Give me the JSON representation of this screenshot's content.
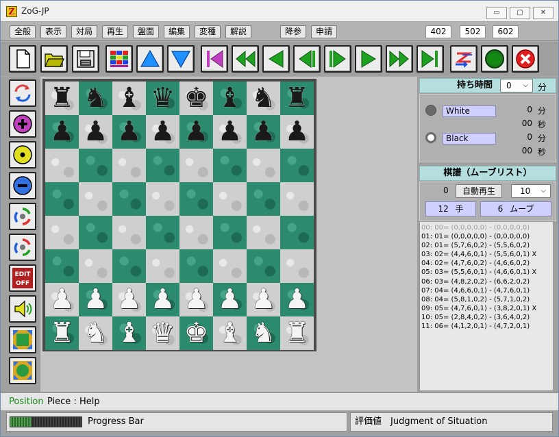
{
  "window": {
    "title": "ZoG-JP",
    "app_icon_letter": "Z",
    "minimize_glyph": "▭",
    "maximize_glyph": "▢",
    "close_glyph": "✕"
  },
  "menu": {
    "items": [
      "全般",
      "表示",
      "対局",
      "再生",
      "盤面",
      "編集",
      "変種",
      "解説"
    ],
    "right_items": [
      "降参",
      "申請"
    ],
    "numbers": [
      "402",
      "502",
      "602"
    ]
  },
  "toolbar": {
    "icons": [
      "new-file-icon",
      "open-folder-icon",
      "save-disk-icon",
      "board-grid-icon",
      "triangle-up-icon",
      "triangle-down-icon",
      "go-first-icon",
      "fast-back-icon",
      "step-back-icon",
      "back-pause-icon",
      "play-pause-icon",
      "step-forward-icon",
      "fast-forward-icon",
      "go-last-icon",
      "zog-swap-icon",
      "green-circle-icon",
      "red-x-icon"
    ]
  },
  "leftbar": {
    "icons": [
      "rotate-board-icon",
      "plus-icon",
      "dot-icon",
      "minus-icon",
      "cycle-icon",
      "cycle-alt-icon",
      "edit-off-icon",
      "speaker-icon",
      "expand-icon",
      "fit-icon"
    ],
    "edit_off_text_1": "EDIT",
    "edit_off_text_2": "OFF"
  },
  "board": {
    "rows": [
      [
        "r",
        "n",
        "b",
        "q",
        "k",
        "b",
        "n",
        "r"
      ],
      [
        "p",
        "p",
        "p",
        "p",
        "p",
        "p",
        "p",
        "p"
      ],
      [
        "",
        "",
        "",
        "",
        "",
        "",
        "",
        ""
      ],
      [
        "",
        "",
        "",
        "",
        "",
        "",
        "",
        ""
      ],
      [
        "",
        "",
        "",
        "",
        "",
        "",
        "",
        ""
      ],
      [
        "",
        "",
        "",
        "",
        "",
        "",
        "",
        ""
      ],
      [
        "P",
        "P",
        "P",
        "P",
        "P",
        "P",
        "P",
        "P"
      ],
      [
        "R",
        "N",
        "B",
        "Q",
        "K",
        "B",
        "N",
        "R"
      ]
    ],
    "glyphs": {
      "r": "♜",
      "n": "♞",
      "b": "♝",
      "q": "♛",
      "k": "♚",
      "p": "♟",
      "R": "♜",
      "N": "♞",
      "B": "♝",
      "Q": "♛",
      "K": "♚",
      "P": "♟"
    }
  },
  "time_panel": {
    "title": "持ち時間",
    "minutes_value": "0",
    "minutes_unit": "分",
    "players": [
      {
        "name": "White",
        "minutes": "0",
        "seconds": "00",
        "min_unit": "分",
        "sec_unit": "秒",
        "active": true
      },
      {
        "name": "Black",
        "minutes": "0",
        "seconds": "00",
        "min_unit": "分",
        "sec_unit": "秒",
        "active": false
      }
    ]
  },
  "moves_panel": {
    "title": "棋譜（ムーブリスト）",
    "position_index": "0",
    "autoplay_label": "自動再生",
    "speed_value": "10",
    "hands_count": "12",
    "hands_unit": "手",
    "moves_count": "6",
    "moves_unit": "ムーブ",
    "list": [
      "00: 00= (0,0,0,0,0) - (0,0,0,0,0)",
      "01: 01= (0,0,0,0,0) - (0,0,0,0,0)",
      "02: 01= (5,7,6,0,2) - (5,5,6,0,2)",
      "03: 02= (4,4,6,0,1) - (5,5,6,0,1) X",
      "04: 02= (4,7,6,0,2) - (4,6,6,0,2)",
      "05: 03= (5,5,6,0,1) - (4,6,6,0,1) X",
      "06: 03= (4,8,2,0,2) - (6,6,2,0,2)",
      "07: 04= (4,6,6,0,1) - (4,7,6,0,1)",
      "08: 04= (5,8,1,0,2) - (5,7,1,0,2)",
      "09: 05= (4,7,6,0,1) - (3,8,2,0,1) X",
      "10: 05= (2,8,4,0,2) - (3,6,4,0,2)",
      "11: 06= (4,1,2,0,1) - (4,7,2,0,1)"
    ]
  },
  "status": {
    "position_label": "Position",
    "piece_help": "Piece : Help",
    "progress_label": "Progress Bar",
    "progress_fraction": 0.3,
    "eval_label": "評価値",
    "eval_text": "Judgment of Situation"
  },
  "colors": {
    "dark_square": "#2c8a6e",
    "light_square": "#cfcfcf",
    "section_header": "#b5dede",
    "player_field": "#d0d0ff",
    "position_green": "#1b8a1b"
  }
}
